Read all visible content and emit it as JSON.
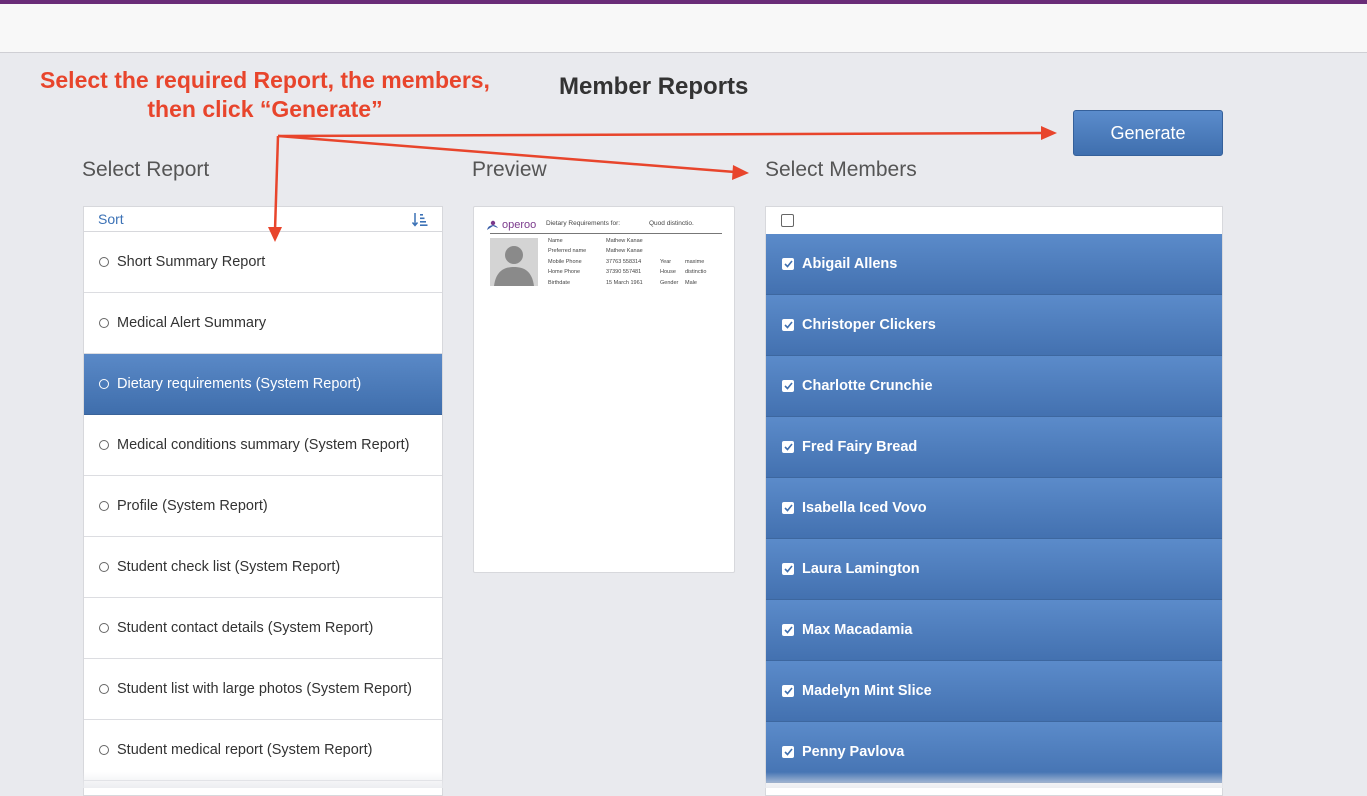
{
  "annotation": {
    "line1": "Select the required Report, the members,",
    "line2": "then click “Generate”",
    "color": "#e8452c"
  },
  "page_title": "Member Reports",
  "generate_button": {
    "label": "Generate"
  },
  "sections": {
    "select_report": "Select Report",
    "preview": "Preview",
    "select_members": "Select Members"
  },
  "report_list": {
    "sort_label": "Sort",
    "sort_icon": "sort-amount-icon",
    "selected_index": 2,
    "items": [
      {
        "label": "Short Summary Report"
      },
      {
        "label": "Medical Alert Summary"
      },
      {
        "label": "Dietary requirements (System Report)"
      },
      {
        "label": "Medical conditions summary (System Report)"
      },
      {
        "label": "Profile (System Report)"
      },
      {
        "label": "Student check list (System Report)"
      },
      {
        "label": "Student contact details (System Report)"
      },
      {
        "label": "Student list with large photos (System Report)"
      },
      {
        "label": "Student medical report (System Report)"
      }
    ]
  },
  "preview": {
    "logo_text": "operoo",
    "heading": "Dietary Requirements for:",
    "heading_value": "Quod distinctio.",
    "name_label": "Name",
    "name_value": "Mathew Kanae",
    "preferred_label": "Preferred name",
    "preferred_value": "Mathew Kanae",
    "mobile_label": "Mobile Phone",
    "mobile_value": "37763 558314",
    "home_label": "Home Phone",
    "home_value": "37390 557481",
    "birth_label": "Birthdate",
    "birth_value": "15 March 1961",
    "year_label": "Year",
    "year_value": "maxime",
    "house_label": "House",
    "house_value": "distinctio",
    "gender_label": "Gender",
    "gender_value": "Male"
  },
  "members": {
    "select_all_checked": false,
    "items": [
      {
        "name": "Abigail Allens",
        "checked": true
      },
      {
        "name": "Christoper Clickers",
        "checked": true
      },
      {
        "name": "Charlotte Crunchie",
        "checked": true
      },
      {
        "name": "Fred Fairy Bread",
        "checked": true
      },
      {
        "name": "Isabella Iced Vovo",
        "checked": true
      },
      {
        "name": "Laura Lamington",
        "checked": true
      },
      {
        "name": "Max Macadamia",
        "checked": true
      },
      {
        "name": "Madelyn Mint Slice",
        "checked": true
      },
      {
        "name": "Penny Pavlova",
        "checked": true
      }
    ]
  },
  "colors": {
    "brand_top_bar": "#6a2c78",
    "accent_blue": "#4a7bbd",
    "link_blue": "#3c72b6"
  }
}
